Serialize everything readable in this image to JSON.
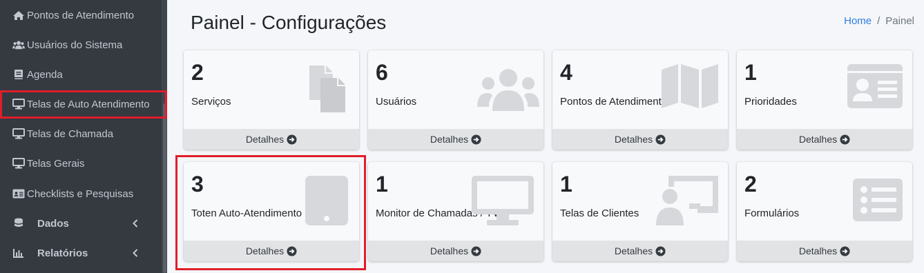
{
  "sidebar": {
    "items": [
      {
        "label": "Pontos de Atendimento",
        "icon": "home-icon"
      },
      {
        "label": "Usuários do Sistema",
        "icon": "users-icon"
      },
      {
        "label": "Agenda",
        "icon": "book-icon"
      },
      {
        "label": "Telas de Auto Atendimento",
        "icon": "desktop-icon"
      },
      {
        "label": "Telas de Chamada",
        "icon": "desktop-icon"
      },
      {
        "label": "Telas Gerais",
        "icon": "desktop-icon"
      },
      {
        "label": "Checklists e Pesquisas",
        "icon": "id-card-icon"
      },
      {
        "label": "Dados",
        "icon": "database-icon"
      },
      {
        "label": "Relatórios",
        "icon": "chart-icon"
      }
    ]
  },
  "header": {
    "title": "Painel - Configurações",
    "breadcrumb": {
      "home": "Home",
      "separator": "/",
      "current": "Painel"
    }
  },
  "cards": [
    {
      "count": "2",
      "label": "Serviços",
      "footer": "Detalhes",
      "icon": "copy-icon"
    },
    {
      "count": "6",
      "label": "Usuários",
      "footer": "Detalhes",
      "icon": "users-icon"
    },
    {
      "count": "4",
      "label": "Pontos de Atendimento",
      "footer": "Detalhes",
      "icon": "map-icon"
    },
    {
      "count": "1",
      "label": "Prioridades",
      "footer": "Detalhes",
      "icon": "id-card-icon"
    },
    {
      "count": "3",
      "label": "Toten Auto-Atendimento",
      "footer": "Detalhes",
      "icon": "tablet-icon"
    },
    {
      "count": "1",
      "label": "Monitor de Chamadas / TVs",
      "footer": "Detalhes",
      "icon": "desktop-icon"
    },
    {
      "count": "1",
      "label": "Telas de Clientes",
      "footer": "Detalhes",
      "icon": "chalkboard-user-icon"
    },
    {
      "count": "2",
      "label": "Formulários",
      "footer": "Detalhes",
      "icon": "list-alt-icon"
    }
  ],
  "colors": {
    "sidebar": "#343a40",
    "highlight": "#e11d2a",
    "link": "#2f7fe0",
    "icon_faded": "#d6d8db"
  }
}
